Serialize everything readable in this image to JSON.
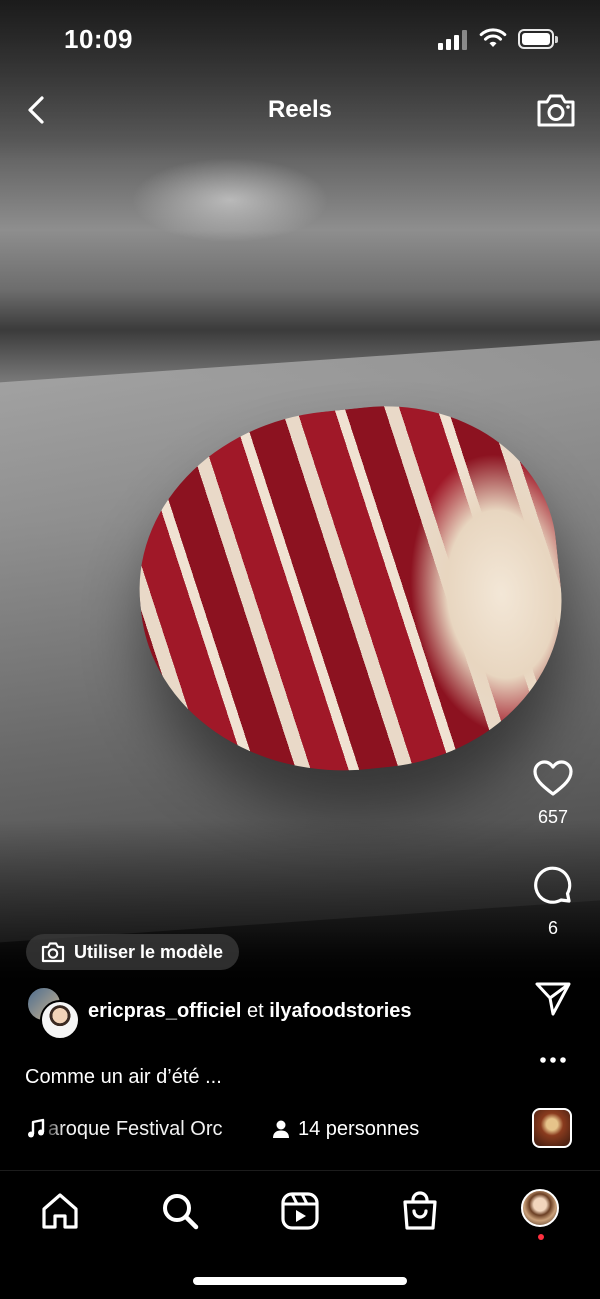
{
  "status_bar": {
    "time": "10:09"
  },
  "header": {
    "title": "Reels"
  },
  "reel": {
    "likes": "657",
    "comments": "6",
    "template_label": "Utiliser le modèle",
    "author_primary": "ericpras_officiel",
    "author_joiner": "et",
    "author_secondary": "ilyafoodstories",
    "caption": "Comme un air d’été ...",
    "music_track": "aroque Festival Orc",
    "people_tagged": "14 personnes"
  },
  "icons": {
    "back": "chevron-left-icon",
    "camera": "camera-icon",
    "like": "heart-icon",
    "comment": "comment-bubble-icon",
    "share": "paper-plane-icon",
    "more": "more-dots-icon",
    "music": "music-note-icon",
    "people": "person-icon",
    "tabs": [
      "home-icon",
      "search-icon",
      "reels-icon",
      "shop-icon",
      "profile-avatar"
    ]
  },
  "colors": {
    "notification_dot": "#ff3040",
    "background": "#000000",
    "text": "#ffffff"
  }
}
